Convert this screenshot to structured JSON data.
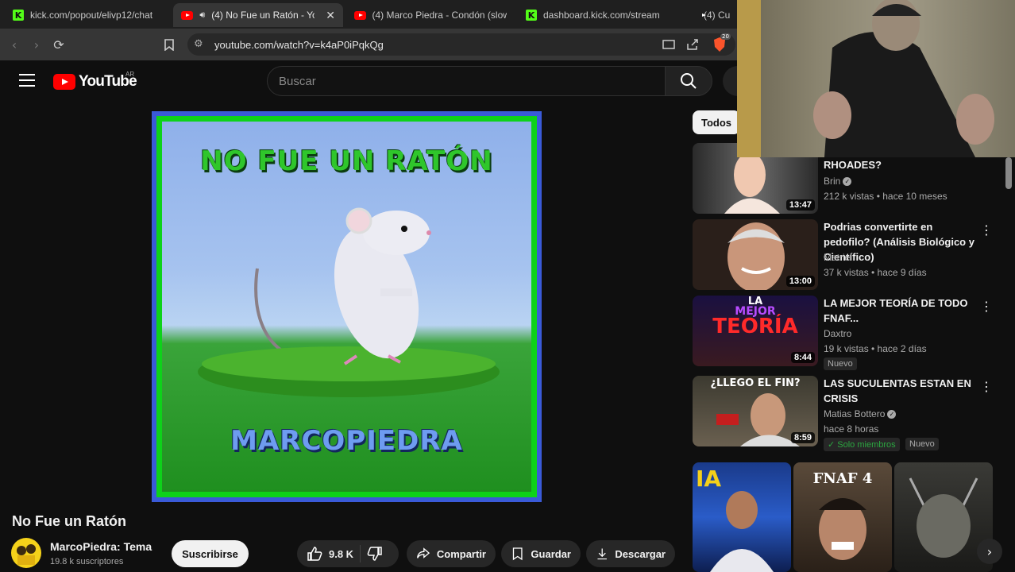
{
  "browser": {
    "tabs": [
      {
        "title": "kick.com/popout/elivp12/chat",
        "favicon": "kick-icon",
        "active": false
      },
      {
        "title": "(4) No Fue un Ratón - YouTube",
        "favicon": "youtube-icon",
        "active": true
      },
      {
        "title": "(4) Marco Piedra - Condón (slowed",
        "favicon": "youtube-icon",
        "active": false
      },
      {
        "title": "dashboard.kick.com/stream",
        "favicon": "kick-icon",
        "active": false
      },
      {
        "title": "(4) Cu",
        "favicon": "youtube-icon",
        "active": false
      }
    ],
    "url": "youtube.com/watch?v=k4aP0iPqkQg",
    "brave_badge": "20"
  },
  "youtube": {
    "logo_text": "YouTube",
    "country": "AR",
    "search_placeholder": "Buscar"
  },
  "video": {
    "art_title": "NO FUE UN RATÓN",
    "art_artist": "MARCOPIEDRA",
    "title": "No Fue un Ratón",
    "channel": "MarcoPiedra: Tema",
    "subscribers": "19.8 k suscriptores",
    "subscribe_label": "Suscribirse",
    "likes": "9.8 K",
    "share_label": "Compartir",
    "save_label": "Guardar",
    "download_label": "Descargar"
  },
  "sidebar": {
    "chip": "Todos",
    "recommendations": [
      {
        "title_visible": "RHOADES?",
        "channel": "Brin",
        "verified": true,
        "meta": "212 k vistas • hace 10 meses",
        "duration": "13:47",
        "badges": []
      },
      {
        "title_visible": "Podrias convertirte en pedofilo? (Análisis Biológico y Científico)",
        "channel": "Matriel",
        "verified": false,
        "meta": "37 k vistas • hace 9 días",
        "duration": "13:00",
        "badges": []
      },
      {
        "title_visible": "LA MEJOR TEORÍA DE TODO FNAF...",
        "channel": "Daxtro",
        "verified": false,
        "meta": "19 k vistas • hace 2 días",
        "duration": "8:44",
        "badges": [
          "Nuevo"
        ],
        "thumb_text_1": "LA",
        "thumb_text_2": "MEJOR",
        "thumb_text_3": "TEORÍA"
      },
      {
        "title_visible": "LAS SUCULENTAS ESTAN EN CRISIS",
        "channel": "Matias Bottero",
        "verified": true,
        "meta": "hace 8 horas",
        "duration": "8:59",
        "badges": [
          "Solo miembros",
          "Nuevo"
        ],
        "thumb_text_1": "¿LLEGO EL FIN?"
      }
    ],
    "shorts": [
      {
        "overlay": "IA"
      },
      {
        "overlay": "FNAF 4"
      },
      {
        "overlay": ""
      }
    ]
  },
  "colors": {
    "background": "#0f0f0f",
    "youtube_red": "#ff0000",
    "kick_green": "#53fc18",
    "art_green": "#0ed21a",
    "art_blue": "#3a5ad8"
  }
}
